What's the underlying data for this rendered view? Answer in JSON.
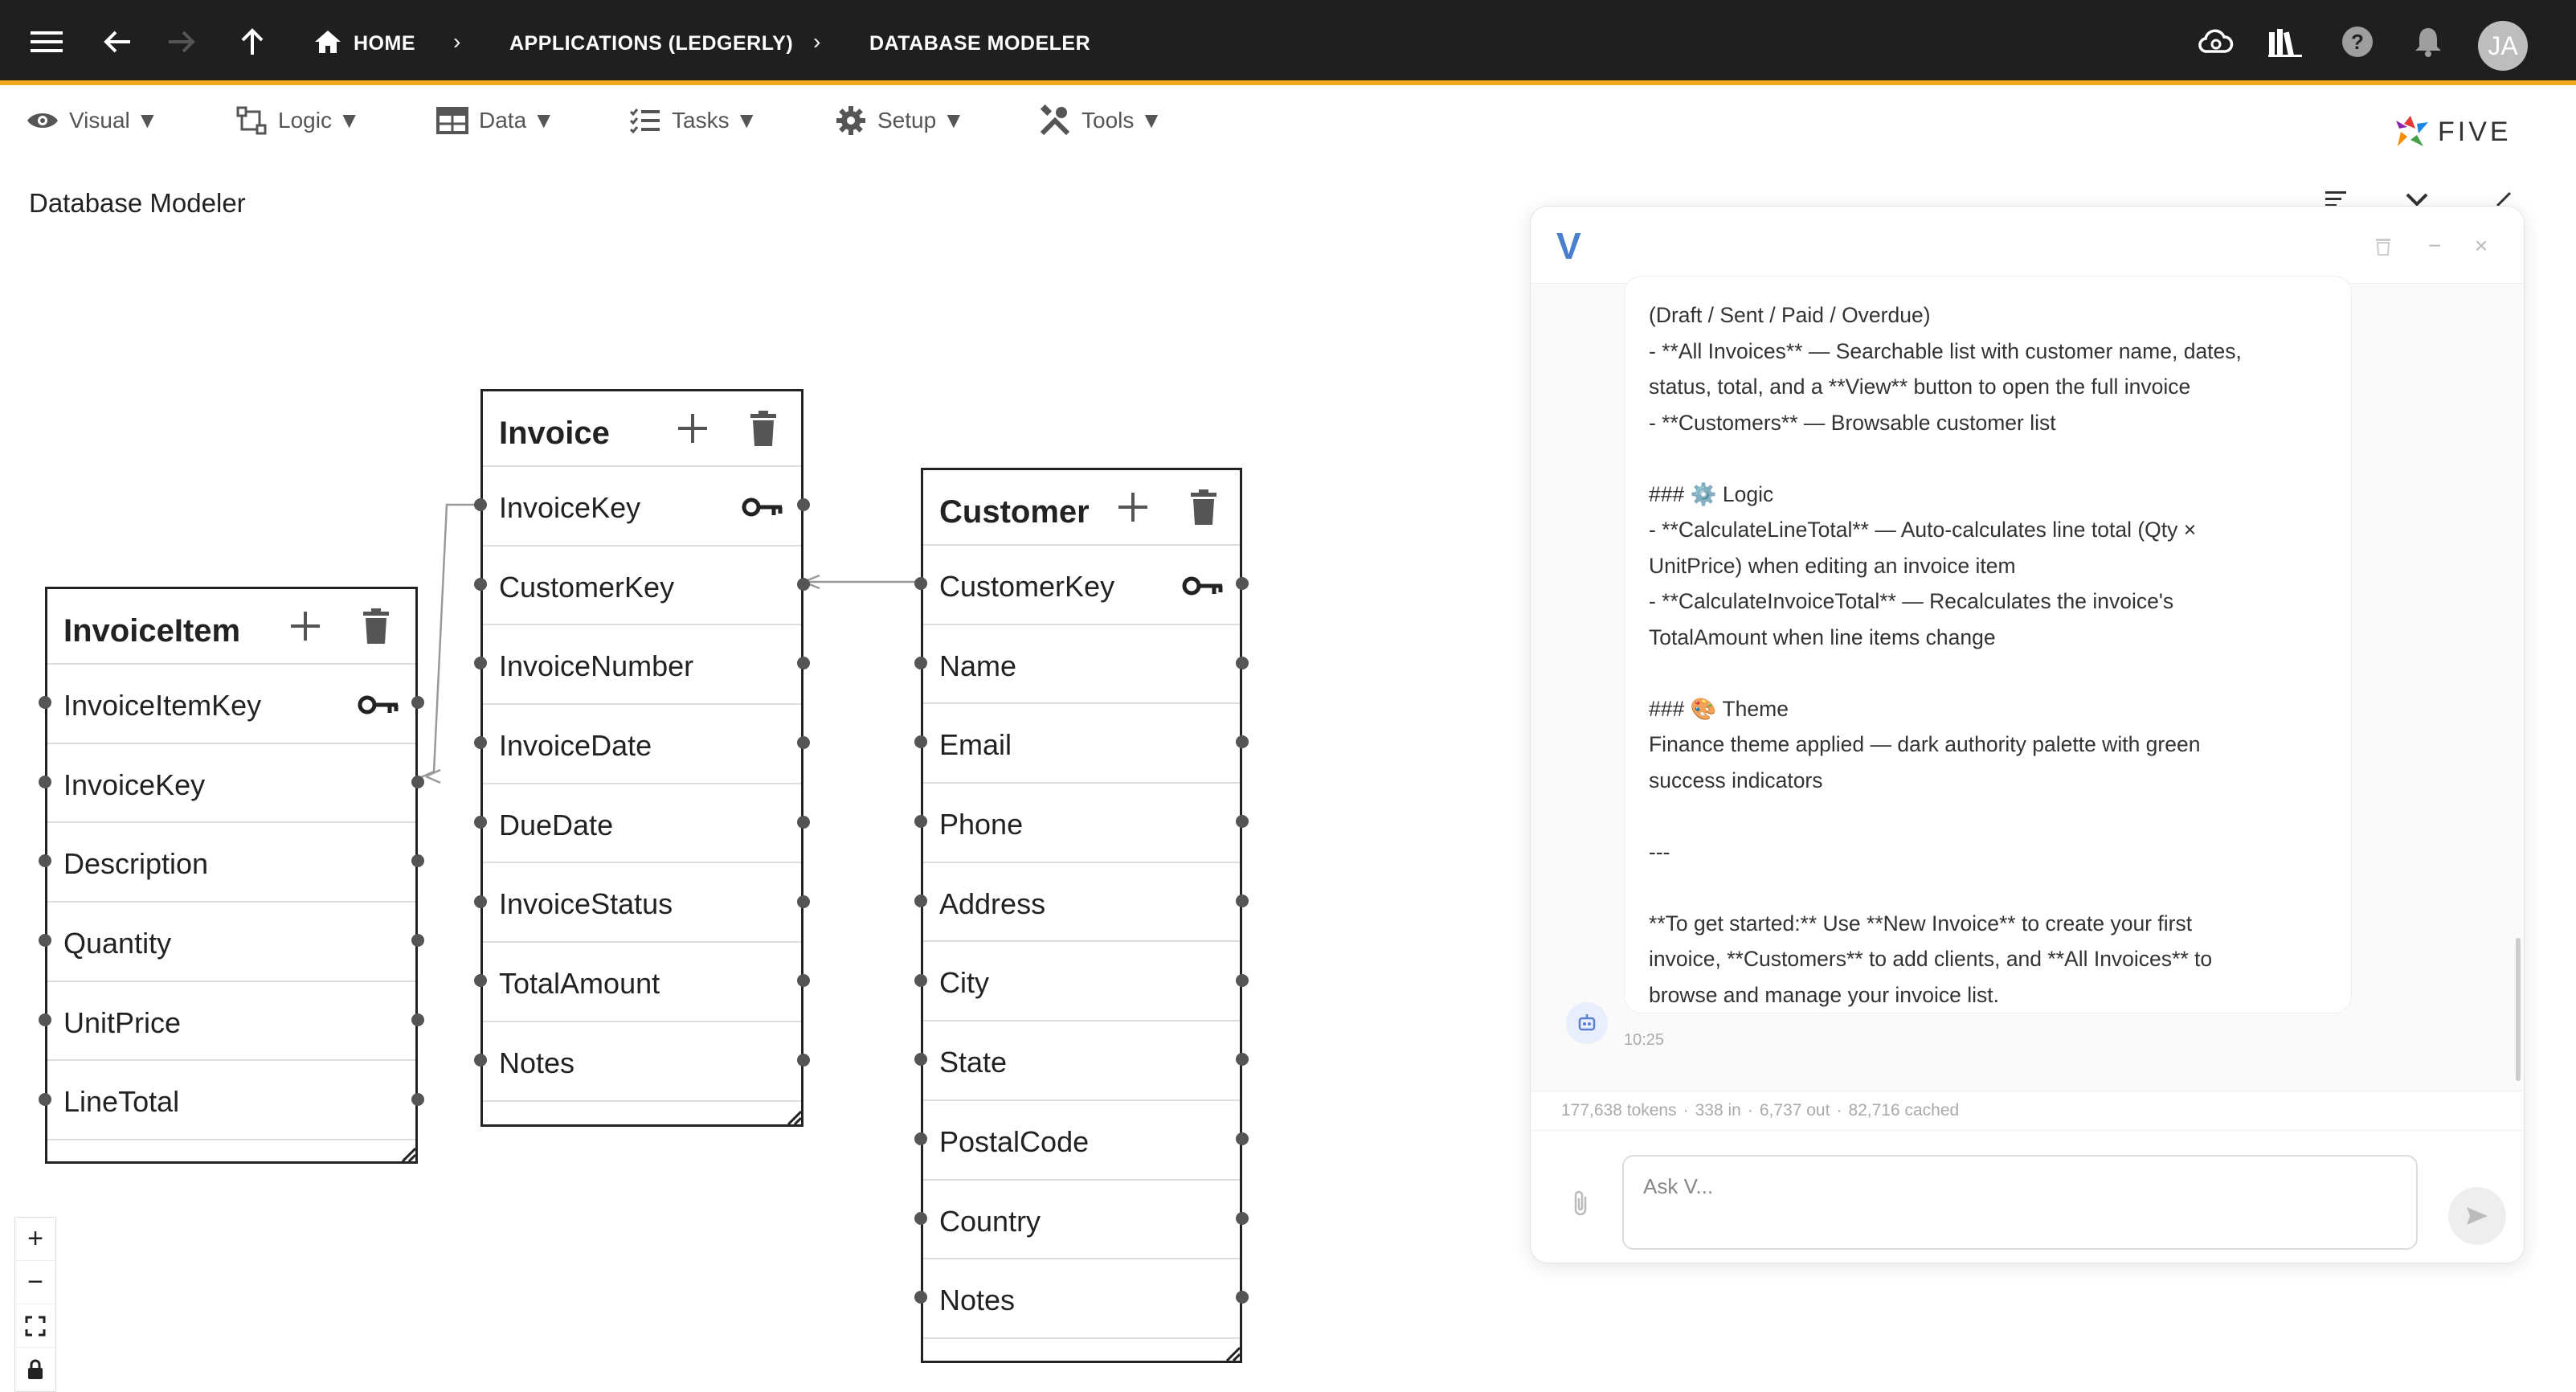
{
  "topbar": {
    "breadcrumbs": [
      "HOME",
      "APPLICATIONS (LEDGERLY)",
      "DATABASE MODELER"
    ],
    "avatar_initials": "JA",
    "accent_color": "#f0a81c"
  },
  "menu": {
    "items": [
      {
        "label": "Visual ▼",
        "icon": "eye-icon"
      },
      {
        "label": "Logic ▼",
        "icon": "logic-icon"
      },
      {
        "label": "Data ▼",
        "icon": "table-icon"
      },
      {
        "label": "Tasks ▼",
        "icon": "tasks-icon"
      },
      {
        "label": "Setup ▼",
        "icon": "gear-icon"
      },
      {
        "label": "Tools ▼",
        "icon": "tools-icon"
      }
    ]
  },
  "logo_text": "FIVE",
  "page_title": "Database Modeler",
  "tables": {
    "invoiceitem": {
      "name": "InvoiceItem",
      "fields": [
        "InvoiceItemKey",
        "InvoiceKey",
        "Description",
        "Quantity",
        "UnitPrice",
        "LineTotal"
      ]
    },
    "invoice": {
      "name": "Invoice",
      "fields": [
        "InvoiceKey",
        "CustomerKey",
        "InvoiceNumber",
        "InvoiceDate",
        "DueDate",
        "InvoiceStatus",
        "TotalAmount",
        "Notes"
      ]
    },
    "customer": {
      "name": "Customer",
      "fields": [
        "CustomerKey",
        "Name",
        "Email",
        "Phone",
        "Address",
        "City",
        "State",
        "PostalCode",
        "Country",
        "Notes"
      ]
    }
  },
  "chat": {
    "logo": "V",
    "message_text": "(Draft / Sent / Paid / Overdue)\n- **All Invoices** — Searchable list with customer name, dates,\nstatus, total, and a **View** button to open the full invoice\n- **Customers** — Browsable customer list\n\n### ⚙️ Logic\n- **CalculateLineTotal** — Auto-calculates line total (Qty ×\nUnitPrice) when editing an invoice item\n- **CalculateInvoiceTotal** — Recalculates the invoice's\nTotalAmount when line items change\n\n### 🎨 Theme\nFinance theme applied — dark authority palette with green\nsuccess indicators\n\n---\n\n**To get started:** Use **New Invoice** to create your first\ninvoice, **Customers** to add clients, and **All Invoices** to\nbrowse and manage your invoice list.",
    "time": "10:25",
    "tokens": "177,638 tokens",
    "tokens_in": "338 in",
    "tokens_out": "6,737 out",
    "tokens_cached": "82,716 cached",
    "input_placeholder": "Ask V..."
  }
}
